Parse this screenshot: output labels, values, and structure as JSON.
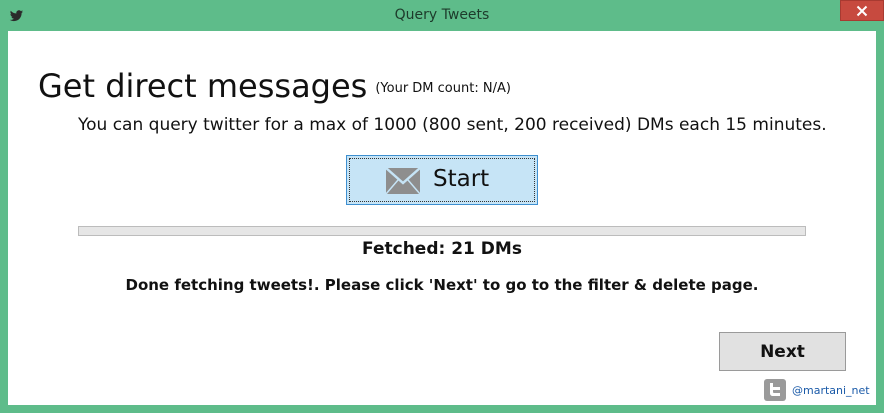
{
  "window": {
    "title": "Query Tweets",
    "app_icon": "twitter-bird-icon",
    "close_icon": "close-icon"
  },
  "main": {
    "heading": "Get direct messages",
    "dm_count": "(Your DM count: N/A)",
    "description": "You can query twitter for a max of 1000 (800 sent, 200 received) DMs each 15 minutes.",
    "start_button": {
      "label": "Start",
      "icon": "envelope-icon"
    },
    "progress": {
      "value": 0
    },
    "fetched_text": "Fetched: 21 DMs",
    "status_text": "Done fetching tweets!. Please click 'Next' to go to the filter & delete page.",
    "next_label": "Next"
  },
  "footer": {
    "credit_icon": "twitter-icon",
    "credit_text": "@martani_net"
  },
  "colors": {
    "frame": "#5ebc8a",
    "close": "#c74a3f",
    "start_bg": "#c6e4f6",
    "start_border": "#3e8fd0",
    "link": "#1a5aa8"
  }
}
